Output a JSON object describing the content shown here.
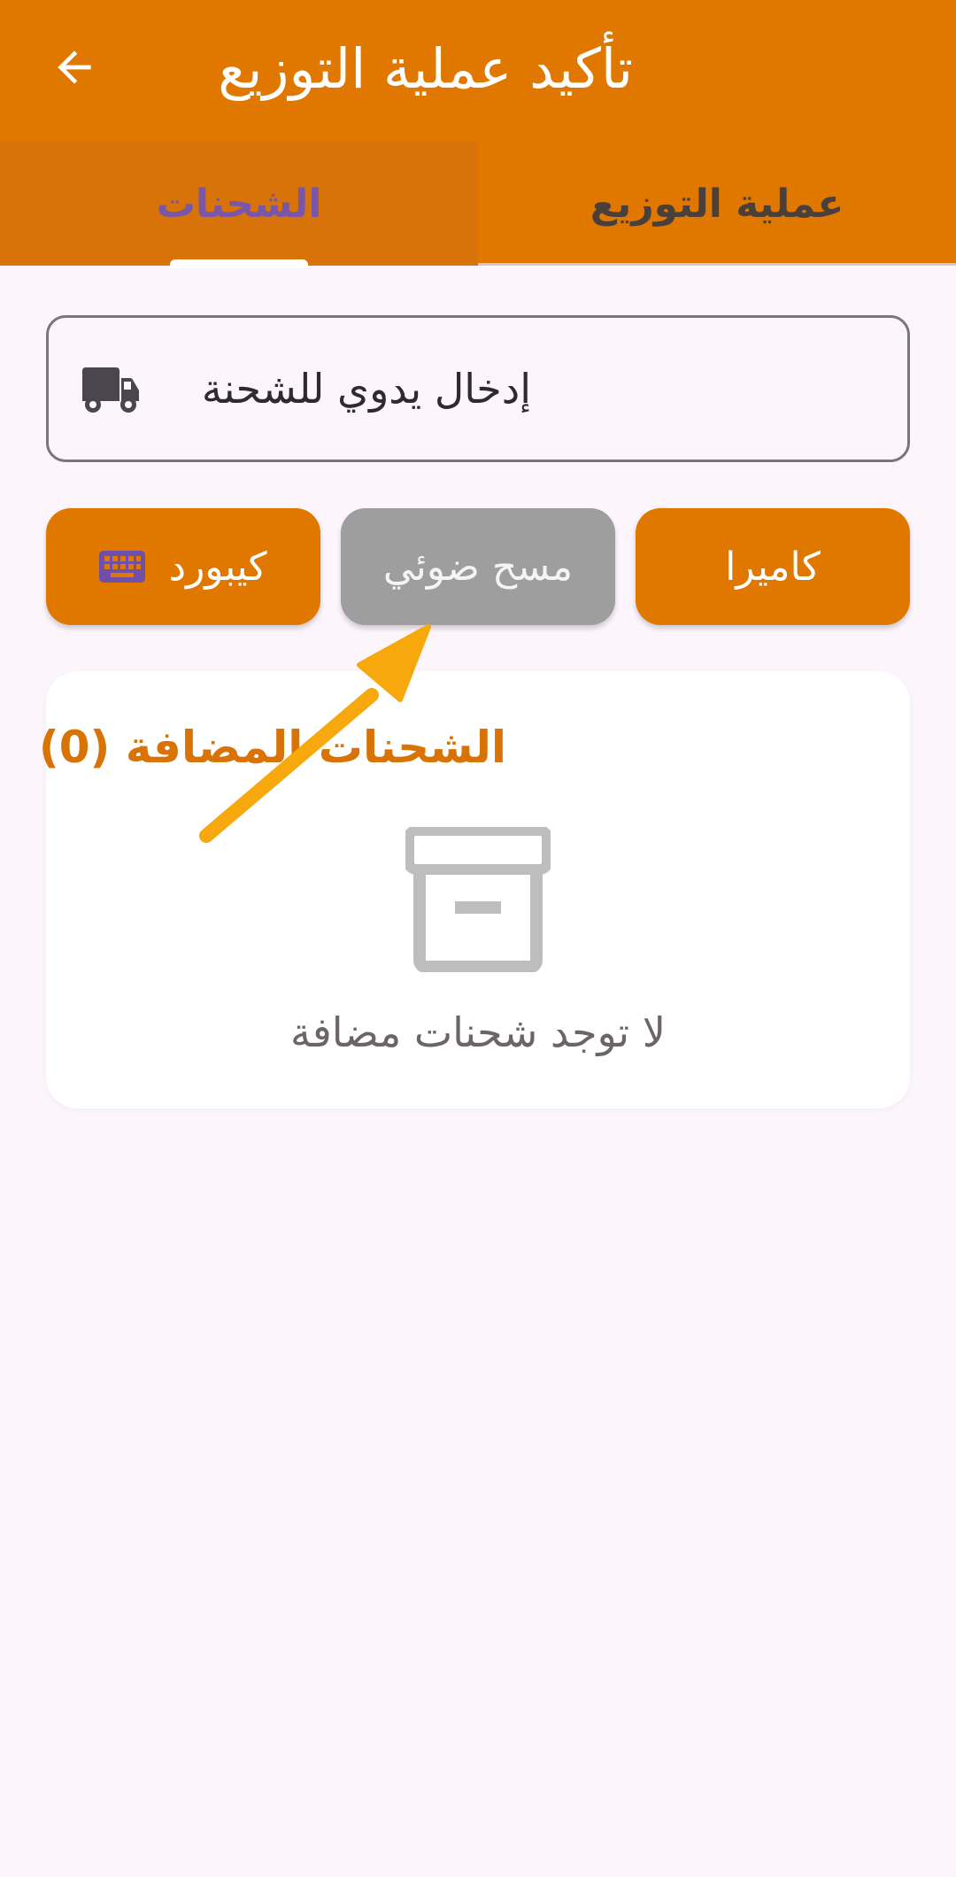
{
  "appbar": {
    "title": "تأكيد عملية التوزيع",
    "back_icon": "arrow-back-icon"
  },
  "tabs": [
    {
      "label": "الشحنات",
      "selected": true
    },
    {
      "label": "عملية التوزيع",
      "selected": false
    }
  ],
  "manual_entry": {
    "placeholder": "إدخال يدوي للشحنة",
    "icon": "truck-icon"
  },
  "buttons": {
    "camera": "كاميرا",
    "scan": "مسح ضوئي",
    "keyboard": "كيبورد",
    "keyboard_icon": "keyboard-icon"
  },
  "added": {
    "title": "الشحنات المضافة (0)",
    "empty_icon": "archive-box-icon",
    "empty_text": "لا توجد شحنات مضافة"
  },
  "colors": {
    "primary": "#e07800",
    "tab_selected_text": "#7a56a8",
    "scan_button": "#9e9e9e",
    "arrow_annotation": "#f6a80c"
  }
}
